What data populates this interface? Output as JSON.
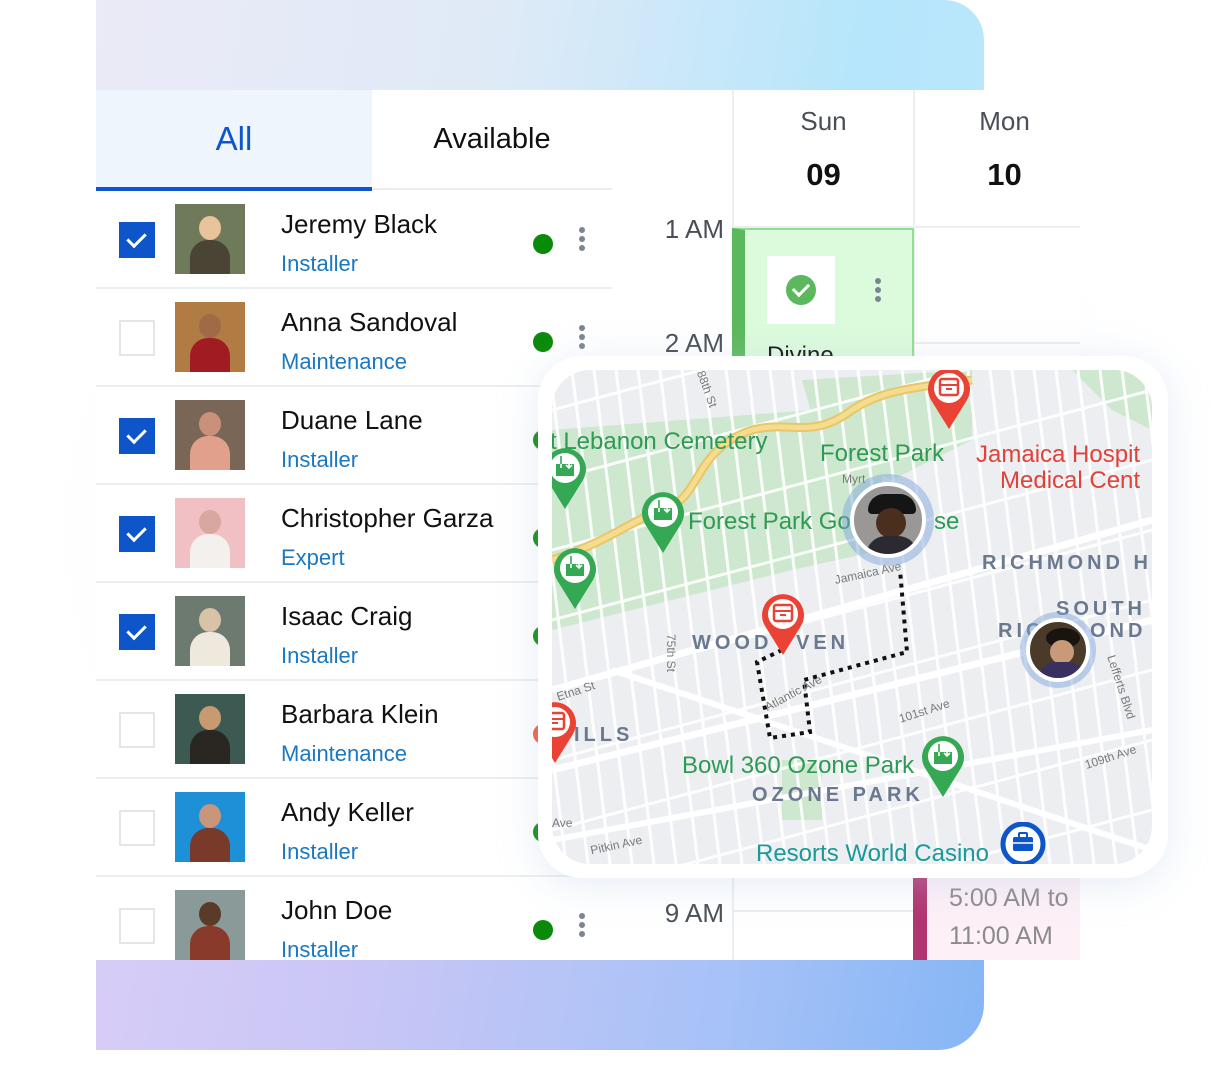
{
  "tabs": [
    {
      "label": "All",
      "active": true
    },
    {
      "label": "Available",
      "active": false
    }
  ],
  "technicians": [
    {
      "name": "Jeremy Black",
      "role": "Installer",
      "checked": true,
      "status": "available",
      "status_color": "#0a8a0a",
      "photo_bg": "#6f7a5a",
      "photo_skin": "#e8c39b",
      "photo_cloth": "#4a4434"
    },
    {
      "name": "Anna Sandoval",
      "role": "Maintenance",
      "checked": false,
      "status": "available",
      "status_color": "#0a8a0a",
      "photo_bg": "#b07c43",
      "photo_skin": "#a06a46",
      "photo_cloth": "#a01c22"
    },
    {
      "name": "Duane Lane",
      "role": "Installer",
      "checked": true,
      "status": "available",
      "status_color": "#0a8a0a",
      "photo_bg": "#7a6656",
      "photo_skin": "#c9917a",
      "photo_cloth": "#e0a08c"
    },
    {
      "name": "Christopher Garza",
      "role": "Expert",
      "checked": true,
      "status": "available",
      "status_color": "#0a8a0a",
      "photo_bg": "#f0c0c4",
      "photo_skin": "#d8a8a0",
      "photo_cloth": "#f4f0ee"
    },
    {
      "name": "Isaac Craig",
      "role": "Installer",
      "checked": true,
      "status": "available",
      "status_color": "#0a8a0a",
      "photo_bg": "#6c7a70",
      "photo_skin": "#d8c2a8",
      "photo_cloth": "#efe8dc"
    },
    {
      "name": "Barbara Klein",
      "role": "Maintenance",
      "checked": false,
      "status": "busy",
      "status_color": "#f05a3c",
      "photo_bg": "#3c5a52",
      "photo_skin": "#c89a72",
      "photo_cloth": "#2a2622"
    },
    {
      "name": "Andy Keller",
      "role": "Installer",
      "checked": false,
      "status": "available",
      "status_color": "#0a8a0a",
      "photo_bg": "#1e90d8",
      "photo_skin": "#c8967a",
      "photo_cloth": "#7a3a2a"
    },
    {
      "name": "John Doe",
      "role": "Installer",
      "checked": false,
      "status": "available",
      "status_color": "#0a8a0a",
      "photo_bg": "#8a9a98",
      "photo_skin": "#5a3a28",
      "photo_cloth": "#8a3a2a"
    }
  ],
  "time_labels": [
    "1 AM",
    "2 AM",
    "9 AM"
  ],
  "days": [
    {
      "name": "Sun",
      "date": "09"
    },
    {
      "name": "Mon",
      "date": "10"
    }
  ],
  "events": {
    "sunday_event": {
      "title": "Divine",
      "status": "completed",
      "color": "#5cb85c"
    },
    "monday_event": {
      "time_line1": "5:00 AM to",
      "time_line2": "11:00 AM",
      "color": "#b03570"
    }
  },
  "map": {
    "labels": {
      "cemetery": "t Lebanon Cemetery",
      "forest_park": "Forest Park",
      "forest_park_golf": "Forest Park Go",
      "golf_suffix": "se",
      "hospital_line1": "Jamaica Hospit",
      "hospital_line2": "Medical Cent",
      "richmond_hill": "RICHMOND HI",
      "south": "SOUTH",
      "richmond": "RIC",
      "richmond_end": "OND I",
      "woodhaven_a": "WOOD",
      "woodhaven_b": "VEN",
      "hills": "ILLS",
      "bowl": "Bowl 360 Ozone Park",
      "ozone_park": "OZONE PARK",
      "casino": "Resorts World Casino",
      "street_88th": "88th St",
      "street_75th": "75th St",
      "jamaica_ave": "Jamaica Ave",
      "atlantic_ave": "Atlantic Ave",
      "street_101st": "101st Ave",
      "street_109th": "109th Ave",
      "lefferts": "Lefferts Blvd",
      "etna": "Etna St",
      "pitkin": "Pitkin Ave",
      "ave": "Ave",
      "myrtle": "Myrt"
    },
    "colors": {
      "install_pin": "#34a853",
      "delivery_pin": "#ea4335",
      "job_pin": "#0d55c9",
      "route": "#111111"
    }
  }
}
